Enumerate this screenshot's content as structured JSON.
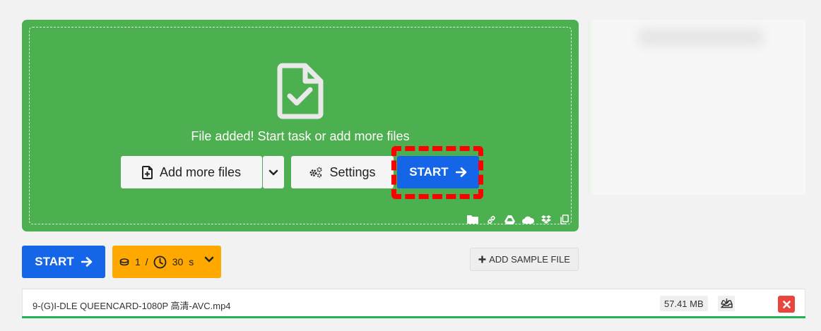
{
  "dropzone": {
    "message": "File added! Start task or add more files",
    "bg_color": "#4caf50",
    "add_more_label": "Add more files",
    "settings_label": "Settings",
    "start_label": "START",
    "source_icons": [
      "folder-icon",
      "link-icon",
      "google-drive-icon",
      "onedrive-icon",
      "dropbox-icon",
      "clipboard-icon"
    ]
  },
  "actions": {
    "start_label": "START",
    "credits_count": "1",
    "credits_sep": "/",
    "time_value": "30",
    "time_unit": "s",
    "sample_label": "ADD SAMPLE FILE"
  },
  "colors": {
    "accent_blue": "#1565e8",
    "credits_orange": "#ffa800",
    "progress_green": "#22b450",
    "remove_red": "#e8453c",
    "highlight_red": "#ff0000"
  },
  "file": {
    "name": "9-(G)I-DLE QUEENCARD-1080P 高清-AVC.mp4",
    "size": "57.41 MB",
    "progress": 1.0
  }
}
